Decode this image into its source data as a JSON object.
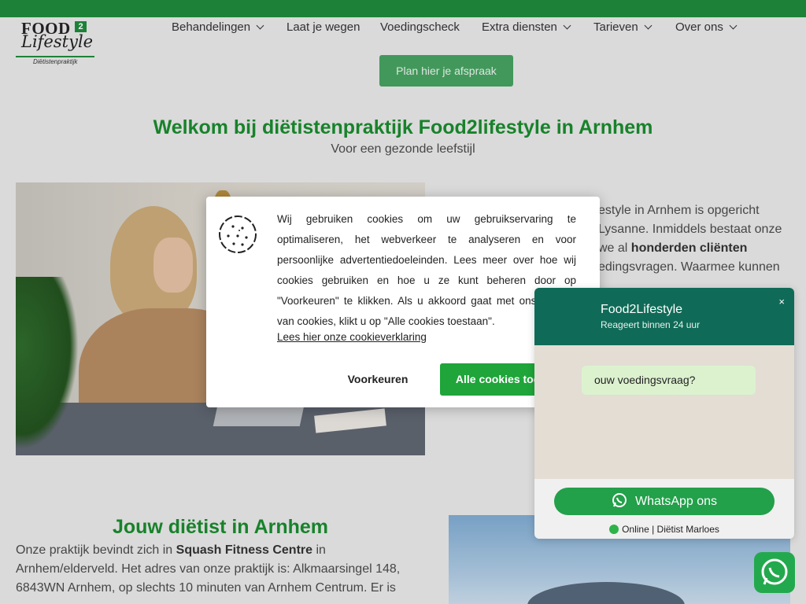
{
  "header": {
    "logo": {
      "line1": "FOOD",
      "badge": "2",
      "line2": "Lifestyle",
      "line3": "Diëtistenpraktijk"
    },
    "nav": [
      {
        "label": "Behandelingen",
        "dropdown": true
      },
      {
        "label": "Laat je wegen",
        "dropdown": false
      },
      {
        "label": "Voedingscheck",
        "dropdown": false
      },
      {
        "label": "Extra diensten",
        "dropdown": true
      },
      {
        "label": "Tarieven",
        "dropdown": true
      },
      {
        "label": "Over ons",
        "dropdown": true
      }
    ],
    "cta": "Plan hier je afspraak"
  },
  "hero": {
    "title": "Welkom bij diëtistenpraktijk Food2lifestyle in Arnhem",
    "subtitle": "Voor een gezonde leefstijl"
  },
  "intro_text": {
    "line1": "estyle in Arnhem is opgericht",
    "line2": "Lysanne. Inmiddels bestaat onze",
    "line3_prefix": "we al ",
    "line3_bold": "honderden cliënten",
    "line4": "edingsvragen. Waarmee kunnen"
  },
  "section": {
    "title": "Jouw diëtist in Arnhem",
    "l1_prefix": "Onze praktijk bevindt zich in ",
    "l1_bold": "Squash Fitness Centre",
    "l1_suffix": " in",
    "l2": "Arnhem/elderveld. Het adres van onze praktijk is: Alkmaarsingel 148,",
    "l3": "6843WN Arnhem, op slechts 10 minuten van Arnhem Centrum. Er is"
  },
  "cookie": {
    "text": "Wij gebruiken cookies om uw gebruikservaring te optimaliseren, het webverkeer te analyseren en voor persoonlijke advertentiedoeleinden. Lees meer over hoe wij cookies gebruiken en hoe u ze kunt beheren door op \"Voorkeuren\" te klikken. Als u akkoord gaat met ons gebruik van cookies, klikt u op \"Alle cookies toestaan\".",
    "link": "Lees hier onze cookieverklaring",
    "preferences": "Voorkeuren",
    "accept_all": "Alle cookies toestaan"
  },
  "whatsapp": {
    "name": "Food2Lifestyle",
    "subtitle": "Reageert binnen 24 uur",
    "close": "×",
    "message": "ouw voedingsvraag?",
    "button": "WhatsApp ons",
    "status": "Online | Diëtist Marloes"
  },
  "colors": {
    "brand_green": "#1f8a3a",
    "title_green": "#1a8a2e",
    "whatsapp_dark": "#0f6b57",
    "whatsapp_green": "#22a04a"
  }
}
